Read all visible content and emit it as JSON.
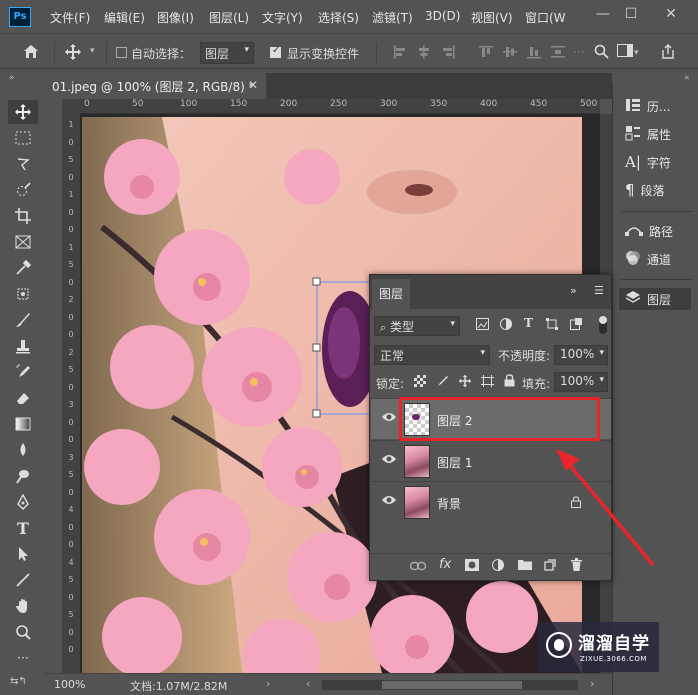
{
  "menubar": {
    "logo": "Ps",
    "items": [
      "文件(F)",
      "编辑(E)",
      "图像(I)",
      "图层(L)",
      "文字(Y)",
      "选择(S)",
      "滤镜(T)",
      "3D(D)",
      "视图(V)",
      "窗口(W"
    ],
    "controls": {
      "minimize": "—",
      "maximize": "☐",
      "close": "✕"
    }
  },
  "options": {
    "auto_select_label": "自动选择：",
    "auto_select_value": "图层",
    "show_transform_label": "显示变换控件"
  },
  "document": {
    "tab_title": "01.jpeg @ 100% (图层 2, RGB/8) *",
    "tab_close": "✕"
  },
  "ruler": {
    "top_ticks": [
      "0",
      "50",
      "100",
      "150",
      "200",
      "250",
      "300",
      "350",
      "400",
      "450",
      "500"
    ],
    "left_ticks": [
      "1",
      "0",
      "5",
      "0",
      "1",
      "0",
      "0",
      "1",
      "5",
      "0",
      "2",
      "0",
      "0",
      "2",
      "5",
      "0",
      "3",
      "0",
      "0",
      "3",
      "5",
      "0",
      "4",
      "0",
      "0",
      "4",
      "5",
      "0",
      "5",
      "0",
      "0"
    ]
  },
  "status": {
    "zoom": "100%",
    "doc_info": "文档:1.07M/2.82M"
  },
  "right_panels": {
    "items": [
      {
        "icon": "history-icon",
        "label": "历..."
      },
      {
        "icon": "properties-icon",
        "label": "属性"
      },
      {
        "icon": "character-icon",
        "label": "字符"
      },
      {
        "icon": "paragraph-icon",
        "label": "段落"
      },
      {
        "icon": "paths-icon",
        "label": "路径"
      },
      {
        "icon": "channels-icon",
        "label": "通道"
      },
      {
        "icon": "layers-icon",
        "label": "图层"
      }
    ]
  },
  "layers_panel": {
    "tab_label": "图层",
    "filter_label": "类型",
    "blend_mode": "正常",
    "opacity_label": "不透明度:",
    "opacity_value": "100%",
    "lock_label": "锁定:",
    "fill_label": "填充:",
    "fill_value": "100%",
    "layers": [
      {
        "name": "图层 2",
        "selected": true,
        "thumb": "transparent"
      },
      {
        "name": "图层 1",
        "selected": false,
        "thumb": "photo"
      },
      {
        "name": "背景",
        "selected": false,
        "thumb": "photo",
        "locked": true
      }
    ]
  },
  "watermark": {
    "title": "溜溜自学",
    "url": "ZIXUE.3066.COM"
  },
  "colors": {
    "ui_bg": "#535353",
    "highlight": "#e8262a",
    "selected_row": "#6b6b6b"
  }
}
